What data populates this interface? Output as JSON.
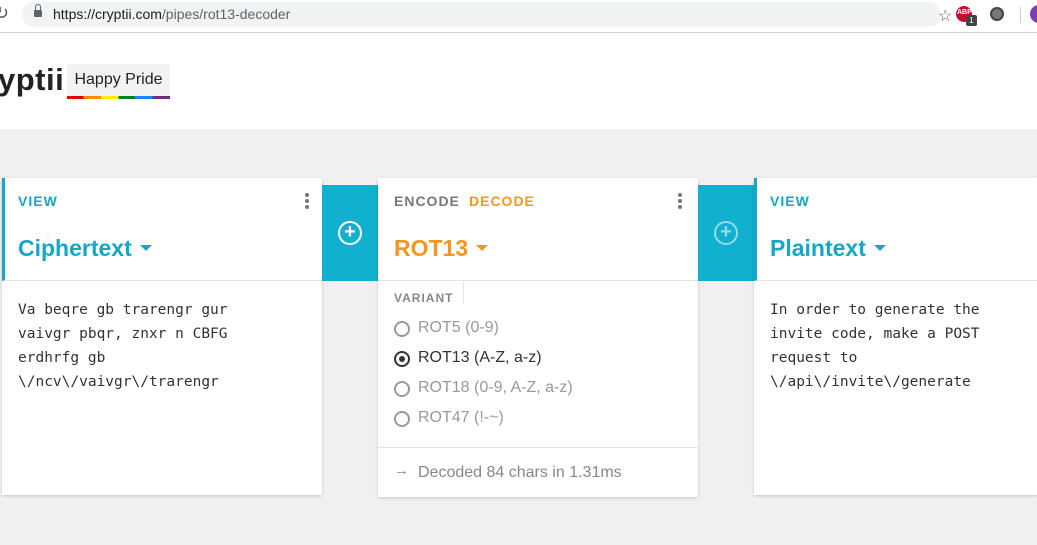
{
  "browser": {
    "url_domain": "https://cryptii.com",
    "url_path": "/pipes/rot13-decoder",
    "abp_badge": "1",
    "abp_text": "ABP"
  },
  "header": {
    "logo": "yptii",
    "pride_button": "Happy Pride"
  },
  "cards": {
    "ciphertext": {
      "type_label": "VIEW",
      "title": "Ciphertext",
      "content": "Va beqre gb trarengr gur\nvaivgr pbqr, znxr n CBFG\nerdhrfg gb\n\\/ncv\\/vaivgr\\/trarengr"
    },
    "rot13": {
      "tab_encode": "ENCODE",
      "tab_decode": "DECODE",
      "title": "ROT13",
      "variant_label": "VARIANT",
      "variants": [
        {
          "label": "ROT5 (0-9)",
          "selected": false
        },
        {
          "label": "ROT13 (A-Z, a-z)",
          "selected": true
        },
        {
          "label": "ROT18 (0-9, A-Z, a-z)",
          "selected": false
        },
        {
          "label": "ROT47 (!-~)",
          "selected": false
        }
      ],
      "status": "Decoded 84 chars in 1.31ms"
    },
    "plaintext": {
      "type_label": "VIEW",
      "title": "Plaintext",
      "content": "In order to generate the\ninvite code, make a POST\nrequest to\n\\/api\\/invite\\/generate"
    }
  },
  "colors": {
    "accent_cyan": "#16a6c6",
    "accent_orange": "#f5961f",
    "connector": "#11b0ce"
  },
  "icons": {
    "add": "plus-circle-icon",
    "menu": "kebab-menu-icon",
    "status": "arrow-right-icon"
  }
}
